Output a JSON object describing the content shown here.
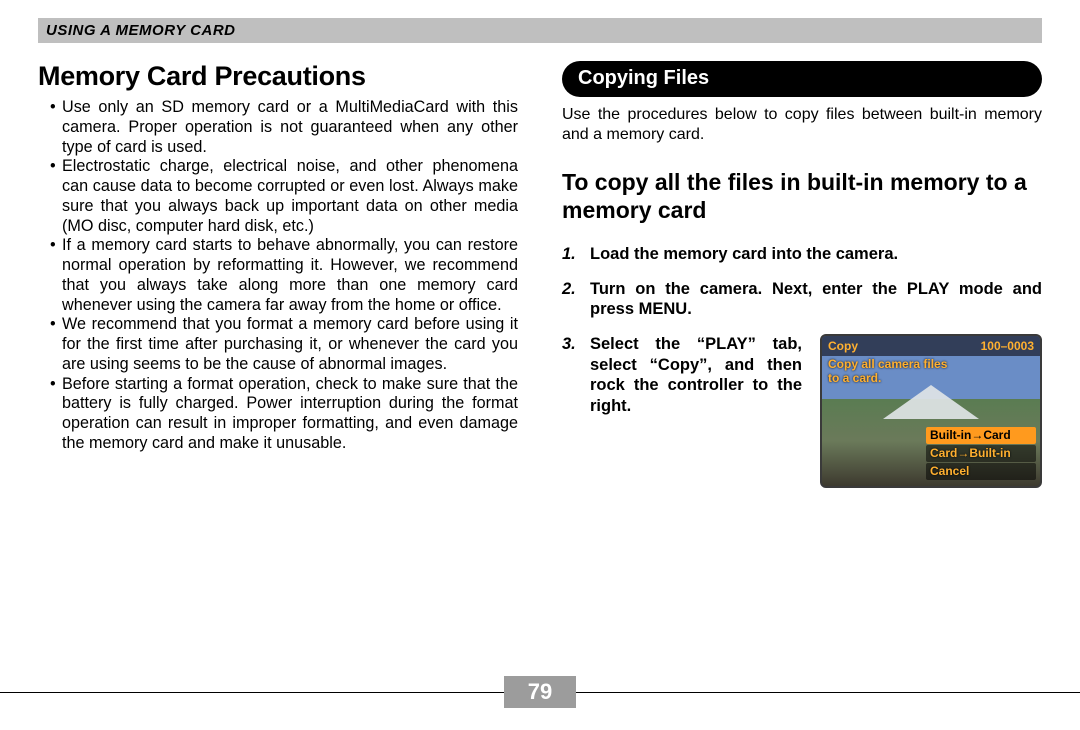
{
  "header": "USING A MEMORY CARD",
  "left": {
    "title": "Memory Card Precautions",
    "b1": "Use only an SD memory card or a MultiMediaCard with this camera. Proper operation is not guaranteed when any other type of card is used.",
    "b2": "Electrostatic charge, electrical noise, and other phenomena can cause data to become corrupted or even lost. Always make sure that you always back up important data on other media (MO disc, computer hard disk, etc.)",
    "b3": "If a memory card starts to behave abnormally, you can restore normal operation by reformatting it. However, we recommend that you always take along more than one memory card whenever using the camera far away from the home or office.",
    "b4": "We recommend that you format a memory card before using it for the first time after purchasing it, or whenever the card you are using seems to be the cause of abnormal images.",
    "b5": "Before starting a format operation, check to make sure that the battery is fully charged. Power interruption during the format operation can result in improper formatting, and even damage the memory card and make it unusable."
  },
  "right": {
    "pill": "Copying Files",
    "intro": "Use the procedures below to copy files between built-in memory and a memory card.",
    "h2": "To copy all the files in built-in memory to a memory card",
    "s1": "Load the memory card into the camera.",
    "s2": "Turn on the camera. Next, enter the PLAY mode and press MENU.",
    "s3": "Select the “PLAY” tab, select “Copy”, and then rock the controller to the right."
  },
  "lcd": {
    "topLeft": "Copy",
    "topRight": "100–0003",
    "sub1": "Copy all camera files",
    "sub2": "to a card.",
    "m1": "Built-in→Card",
    "m2": "Card→Built-in",
    "m3": "Cancel"
  },
  "page": "79"
}
